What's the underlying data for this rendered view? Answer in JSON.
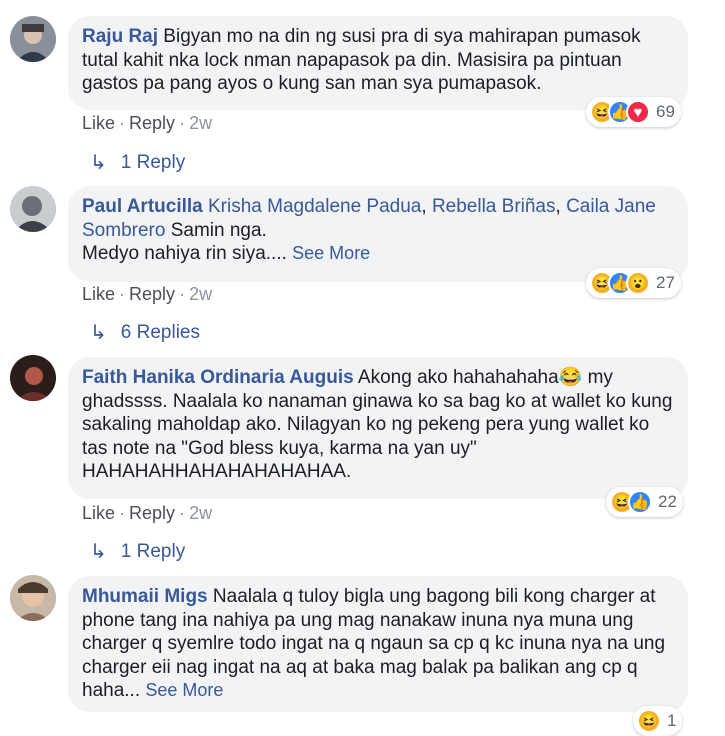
{
  "comments": [
    {
      "author": "Raju Raj",
      "text": " Bigyan mo na din ng susi pra di sya mahirapan pumasok tutal kahit nka lock nman napapasok pa din. Masisira pa pintuan gastos pa pang ayos o kung san man sya pumapasok.",
      "reactions": [
        "haha",
        "like",
        "love"
      ],
      "reaction_count": "69",
      "like_label": "Like",
      "reply_label": "Reply",
      "time": "2w",
      "replies_label": "1 Reply"
    },
    {
      "author": "Paul Artucilla",
      "tags": [
        "Krisha Magdalene Padua",
        "Rebella Briñas",
        "Caila Jane Sombrero"
      ],
      "text": " Samin nga.",
      "text2": "Medyo nahiya rin siya....",
      "see_more": "See More",
      "reactions": [
        "haha",
        "like",
        "wow"
      ],
      "reaction_count": "27",
      "like_label": "Like",
      "reply_label": "Reply",
      "time": "2w",
      "replies_label": "6 Replies"
    },
    {
      "author": "Faith Hanika Ordinaria Auguis",
      "text": " Akong ako hahahahaha😂 my ghadssss. Naalala ko nanaman ginawa ko sa bag ko at wallet ko kung sakaling maholdap ako. Nilagyan ko ng pekeng pera yung wallet ko tas note na \"God bless kuya, karma na yan uy\" HAHAHAHHAHAHAHAHAHAA.",
      "reactions": [
        "haha",
        "like"
      ],
      "reaction_count": "22",
      "like_label": "Like",
      "reply_label": "Reply",
      "time": "2w",
      "replies_label": "1 Reply"
    },
    {
      "author": "Mhumaii Migs",
      "text": " Naalala q tuloy bigla ung bagong bili kong charger at phone tang ina nahiya pa ung mag nanakaw inuna nya muna ung charger q syemlre todo ingat na q ngaun sa cp q kc inuna nya na ung charger eii nag ingat na aq at baka mag balak pa balikan ang cp q haha...",
      "see_more": "See More",
      "reactions": [
        "haha"
      ],
      "reaction_count": "1"
    }
  ],
  "icons": {
    "haha": "😆",
    "like": "👍",
    "love": "♥",
    "wow": "😮",
    "reply_arrow": "↳"
  },
  "colors": {
    "link_blue": "#385898",
    "bubble_bg": "#f2f3f5",
    "meta_gray": "#8d949e"
  }
}
